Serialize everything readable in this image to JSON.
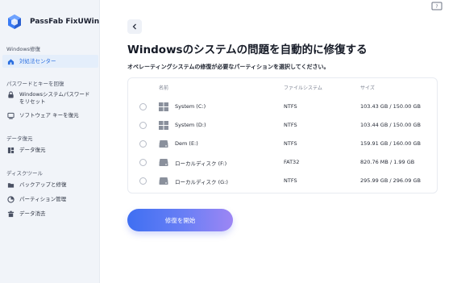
{
  "app": {
    "name": "PassFab FixUWin"
  },
  "colors": {
    "accent": "#2b6fe0",
    "sidebar_bg": "#f1f4f9",
    "button_start": "#3f6ff2",
    "button_end": "#9d86f4"
  },
  "sidebar": {
    "sections": [
      {
        "title": "Windows修復",
        "items": [
          {
            "label": "対処法センター",
            "icon": "home-icon",
            "active": true
          }
        ]
      },
      {
        "title": "パスワードとキーを回復",
        "items": [
          {
            "label": "WindowsシステムパスワードをリセットAR",
            "icon": "lock-icon"
          },
          {
            "label": "ソフトウェア キーを復元",
            "icon": "key-icon"
          }
        ]
      },
      {
        "title": "データ復元",
        "items": [
          {
            "label": "データ復元",
            "icon": "database-icon"
          }
        ]
      },
      {
        "title": "ディスクツール",
        "items": [
          {
            "label": "バックアップと修復",
            "icon": "folder-icon"
          },
          {
            "label": "パーティション管理",
            "icon": "partition-icon"
          },
          {
            "label": "データ消去",
            "icon": "erase-icon"
          }
        ]
      }
    ]
  },
  "main": {
    "title": "Windowsのシステムの問題を自動的に修復する",
    "subtitle": "オペレーティングシステムの修復が必要なパーティションを選択してください。",
    "table": {
      "headers": [
        "名前",
        "ファイルシステム",
        "サイズ"
      ],
      "rows": [
        {
          "name": "System (C:)",
          "fs": "NTFS",
          "size": "103.43 GB / 150.00 GB",
          "icon": "windows-icon"
        },
        {
          "name": "System (D:)",
          "fs": "NTFS",
          "size": "103.44 GB / 150.00 GB",
          "icon": "windows-icon"
        },
        {
          "name": "Dem (E:)",
          "fs": "NTFS",
          "size": "159.91 GB / 160.00 GB",
          "icon": "drive-icon"
        },
        {
          "name": "ローカルディスク (F:)",
          "fs": "FAT32",
          "size": "820.76 MB / 1.99 GB",
          "icon": "drive-icon"
        },
        {
          "name": "ローカルディスク (G:)",
          "fs": "NTFS",
          "size": "295.99 GB / 296.09 GB",
          "icon": "drive-icon"
        }
      ]
    },
    "repair_button": "修復を開始"
  }
}
